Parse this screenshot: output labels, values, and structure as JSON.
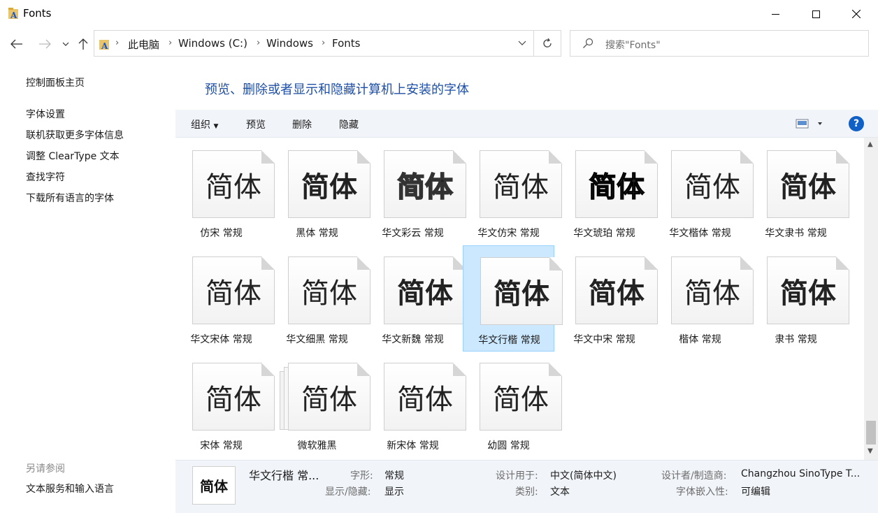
{
  "window": {
    "title": "Fonts"
  },
  "address": {
    "crumbs": [
      "此电脑",
      "Windows (C:)",
      "Windows",
      "Fonts"
    ]
  },
  "search": {
    "placeholder": "搜索\"Fonts\""
  },
  "left_pane": {
    "links": [
      "控制面板主页",
      "字体设置",
      "联机获取更多字体信息",
      "调整 ClearType 文本",
      "查找字符",
      "下载所有语言的字体"
    ],
    "see_also_title": "另请参阅",
    "see_also_links": [
      "文本服务和输入语言"
    ]
  },
  "heading": "预览、删除或者显示和隐藏计算机上安装的字体",
  "toolbar": {
    "organize": "组织",
    "preview": "预览",
    "delete": "删除",
    "hide": "隐藏",
    "help": "?"
  },
  "fonts": [
    {
      "glyph": "简体",
      "label": "仿宋 常规"
    },
    {
      "glyph": "简体",
      "label": "黑体 常规"
    },
    {
      "glyph": "简体",
      "label": "华文彩云 常规"
    },
    {
      "glyph": "简体",
      "label": "华文仿宋 常规"
    },
    {
      "glyph": "简体",
      "label": "华文琥珀 常规"
    },
    {
      "glyph": "简体",
      "label": "华文楷体 常规"
    },
    {
      "glyph": "简体",
      "label": "华文隶书 常规"
    },
    {
      "glyph": "简体",
      "label": "华文宋体 常规"
    },
    {
      "glyph": "简体",
      "label": "华文细黑 常规"
    },
    {
      "glyph": "简体",
      "label": "华文新魏 常规"
    },
    {
      "glyph": "简体",
      "label": "华文行楷 常规"
    },
    {
      "glyph": "简体",
      "label": "华文中宋 常规"
    },
    {
      "glyph": "简体",
      "label": "楷体 常规"
    },
    {
      "glyph": "简体",
      "label": "隶书 常规"
    },
    {
      "glyph": "简体",
      "label": "宋体 常规"
    },
    {
      "glyph": "简体",
      "label": "微软雅黑"
    },
    {
      "glyph": "简体",
      "label": "新宋体 常规"
    },
    {
      "glyph": "简体",
      "label": "幼圆 常规"
    }
  ],
  "selected_index": 10,
  "details": {
    "glyph": "简体",
    "name": "华文行楷 常...",
    "style_key": "字形:",
    "style_val": "常规",
    "show_key": "显示/隐藏:",
    "show_val": "显示",
    "designed_key": "设计用于:",
    "designed_val": "中文(简体中文)",
    "category_key": "类别:",
    "category_val": "文本",
    "designer_key": "设计者/制造商:",
    "designer_val": "Changzhou SinoType T...",
    "embed_key": "字体嵌入性:",
    "embed_val": "可编辑"
  },
  "colors": {
    "accent": "#1e4fa6",
    "selection": "#cce8ff",
    "toolbar_bg": "#f1f4f8",
    "help": "#1160c6"
  }
}
